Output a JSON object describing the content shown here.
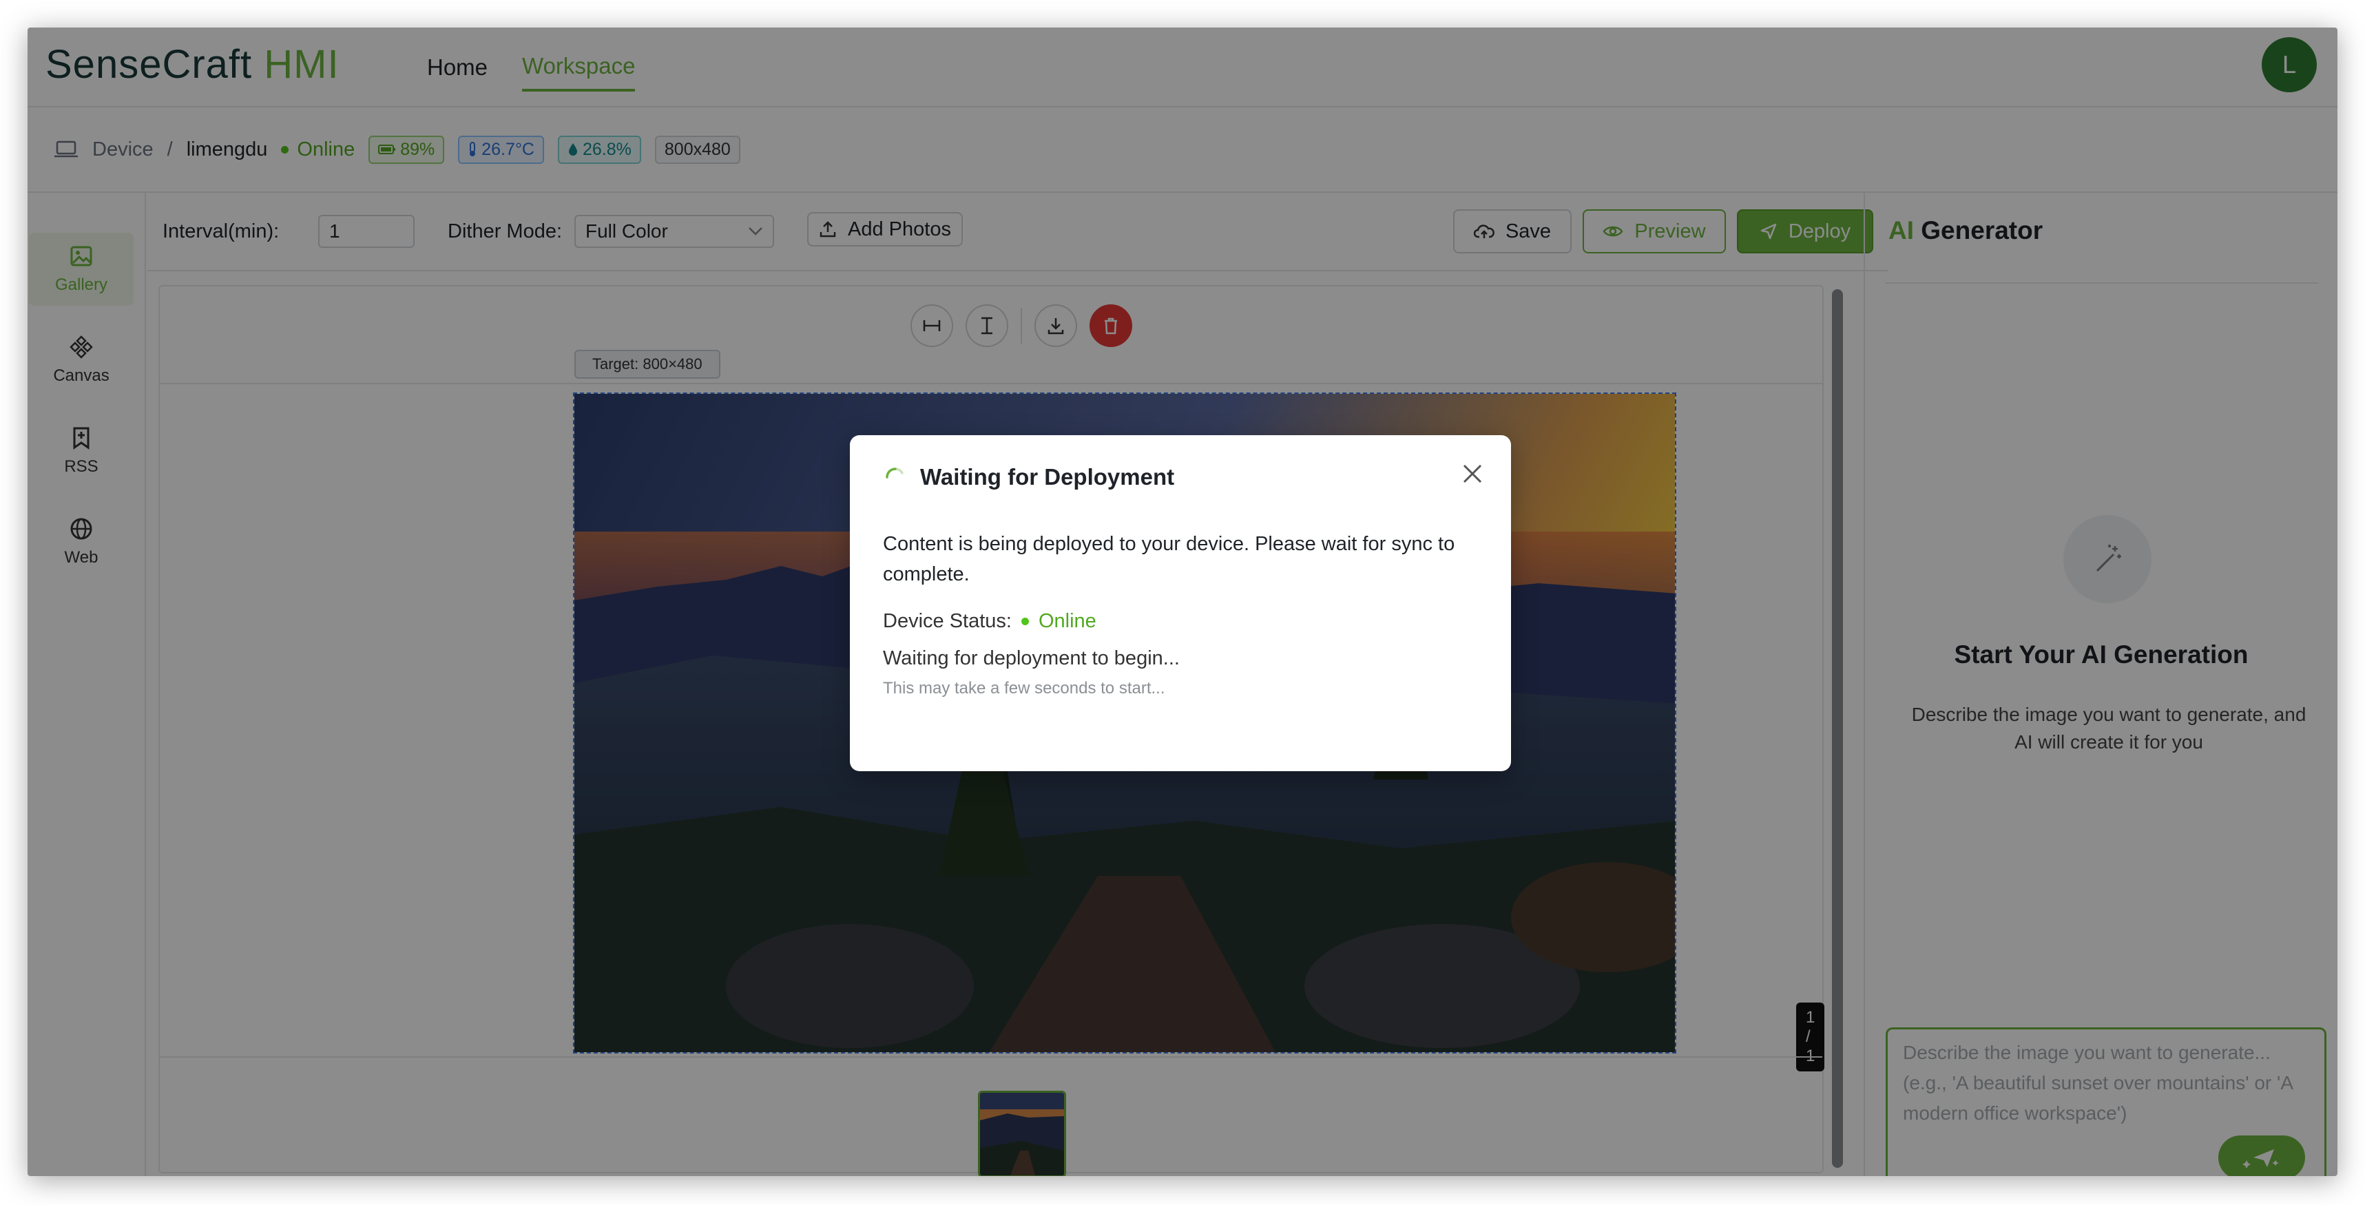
{
  "app": {
    "logo_main": "SenseCraft",
    "logo_accent": "HMI",
    "nav": [
      {
        "label": "Home",
        "active": false
      },
      {
        "label": "Workspace",
        "active": true
      }
    ],
    "avatar_initial": "L"
  },
  "device_bar": {
    "device_label": "Device",
    "separator": "/",
    "device_name": "limengdu",
    "status": "Online",
    "battery": "89%",
    "temperature": "26.7°C",
    "humidity": "26.8%",
    "resolution": "800x480"
  },
  "sidebar": {
    "items": [
      {
        "label": "Gallery",
        "icon": "image-icon",
        "active": true
      },
      {
        "label": "Canvas",
        "icon": "canvas-icon",
        "active": false
      },
      {
        "label": "RSS",
        "icon": "bookmark-plus-icon",
        "active": false
      },
      {
        "label": "Web",
        "icon": "globe-icon",
        "active": false
      }
    ]
  },
  "toolbar": {
    "interval_label": "Interval(min):",
    "interval_value": "1",
    "dither_label": "Dither Mode:",
    "dither_value": "Full Color",
    "add_photos_label": "Add Photos",
    "save_label": "Save",
    "preview_label": "Preview",
    "deploy_label": "Deploy"
  },
  "canvas": {
    "target_label": "Target: 800×480",
    "page_indicator": "1 / 1"
  },
  "ai_panel": {
    "title_accent": "AI",
    "title_rest": "Generator",
    "heading": "Start Your AI Generation",
    "description": "Describe the image you want to generate, and AI will create it for you",
    "input_placeholder": "Describe the image you want to generate... (e.g., 'A beautiful sunset over mountains' or 'A modern office workspace')"
  },
  "modal": {
    "title": "Waiting for Deployment",
    "message": "Content is being deployed to your device. Please wait for sync to complete.",
    "status_label": "Device Status:",
    "status_value": "Online",
    "waiting_text": "Waiting for deployment to begin...",
    "waiting_sub": "This may take a few seconds to start..."
  },
  "colors": {
    "accent": "#6cb33e",
    "online": "#52c41a",
    "danger": "#e53935"
  }
}
